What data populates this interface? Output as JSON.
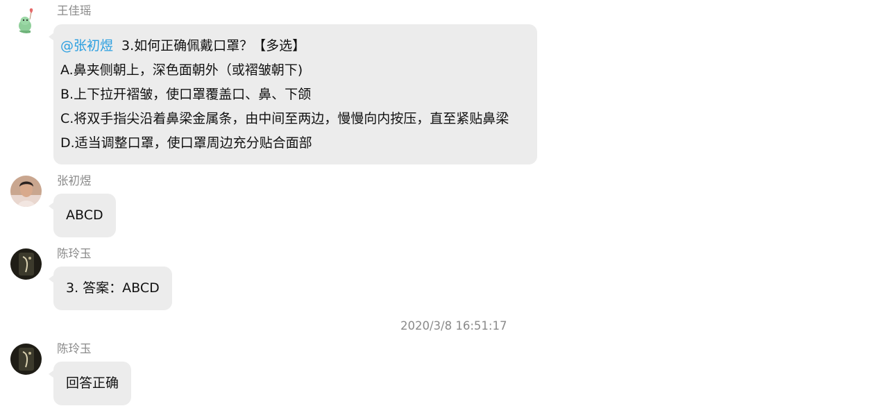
{
  "messages": [
    {
      "sender": "王佳瑶",
      "avatar_icon": "dinosaur-balloon-avatar",
      "mention": "@张初煜",
      "lines": [
        "3.如何正确佩戴口罩？【多选】",
        "A.鼻夹侧朝上，深色面朝外（或褶皱朝下)",
        "B.上下拉开褶皱，使口罩覆盖口、鼻、下颌",
        "C.将双手指尖沿着鼻梁金属条，由中间至两边，慢慢向内按压，直至紧贴鼻梁",
        "D.适当调整口罩，使口罩周边充分贴合面部"
      ]
    },
    {
      "sender": "张初煜",
      "avatar_icon": "person-photo-avatar",
      "text": "ABCD"
    },
    {
      "sender": "陈玲玉",
      "avatar_icon": "dark-photo-avatar",
      "text": "3. 答案：ABCD"
    },
    {
      "sender": "陈玲玉",
      "avatar_icon": "dark-photo-avatar",
      "text": "回答正确"
    }
  ],
  "timestamp": "2020/3/8 16:51:17",
  "colors": {
    "bubble": "#ececec",
    "mention": "#2b9fe0",
    "name": "#8a8a8a"
  }
}
